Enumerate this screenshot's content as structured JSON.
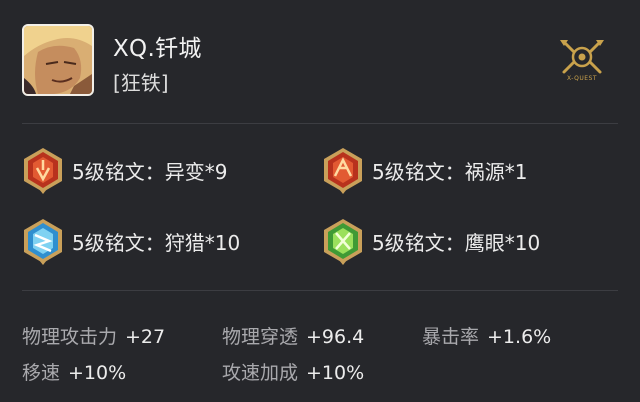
{
  "player": {
    "name": "XQ.钎城",
    "hero": "[狂铁]"
  },
  "logo": {
    "text": "X-QUEST",
    "color": "#c9a24c"
  },
  "runes": [
    {
      "label": "5级铭文：异变*9",
      "color": "red",
      "icon": "rune-red-icon"
    },
    {
      "label": "5级铭文：祸源*1",
      "color": "red",
      "icon": "rune-red-icon"
    },
    {
      "label": "5级铭文：狩猎*10",
      "color": "blue",
      "icon": "rune-blue-icon"
    },
    {
      "label": "5级铭文：鹰眼*10",
      "color": "green",
      "icon": "rune-green-icon"
    }
  ],
  "stats": [
    {
      "name": "物理攻击力",
      "value": "+27"
    },
    {
      "name": "物理穿透",
      "value": "+96.4"
    },
    {
      "name": "暴击率",
      "value": "+1.6%"
    },
    {
      "name": "移速",
      "value": "+10%"
    },
    {
      "name": "攻速加成",
      "value": "+10%"
    }
  ]
}
